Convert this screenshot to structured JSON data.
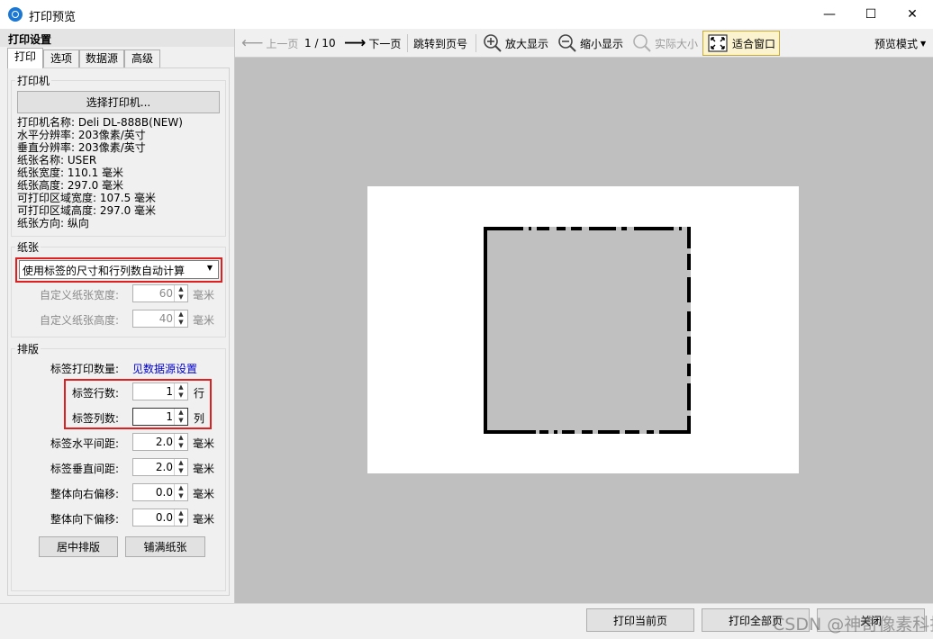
{
  "window": {
    "title": "打印预览",
    "minimize": "—",
    "maximize": "☐",
    "close": "✕"
  },
  "left": {
    "header": "打印设置",
    "tabs": [
      "打印",
      "选项",
      "数据源",
      "高级"
    ],
    "printer": {
      "group_title": "打印机",
      "select_button": "选择打印机...",
      "info": [
        "打印机名称: Deli DL-888B(NEW)",
        "水平分辨率: 203像素/英寸",
        "垂直分辨率: 203像素/英寸",
        "纸张名称: USER",
        "纸张宽度: 110.1 毫米",
        "纸张高度: 297.0 毫米",
        "可打印区域宽度: 107.5 毫米",
        "可打印区域高度: 297.0 毫米",
        "纸张方向: 纵向"
      ]
    },
    "paper": {
      "group_title": "纸张",
      "mode": "使用标签的尺寸和行列数自动计算",
      "custom_width_label": "自定义纸张宽度:",
      "custom_width": "60",
      "custom_height_label": "自定义纸张高度:",
      "custom_height": "40",
      "unit": "毫米"
    },
    "layout": {
      "group_title": "排版",
      "count_label": "标签打印数量:",
      "count_link": "见数据源设置",
      "rows_label": "标签行数:",
      "rows": "1",
      "rows_unit": "行",
      "cols_label": "标签列数:",
      "cols": "1",
      "cols_unit": "列",
      "hgap_label": "标签水平间距:",
      "hgap": "2.0",
      "vgap_label": "标签垂直间距:",
      "vgap": "2.0",
      "xoff_label": "整体向右偏移:",
      "xoff": "0.0",
      "yoff_label": "整体向下偏移:",
      "yoff": "0.0",
      "unit": "毫米",
      "center_button": "居中排版",
      "fill_button": "铺满纸张"
    }
  },
  "toolbar": {
    "prev": "上一页",
    "page": "1 / 10",
    "next": "下一页",
    "goto": "跳转到页号",
    "zoom_in": "放大显示",
    "zoom_out": "缩小显示",
    "actual": "实际大小",
    "fit": "适合窗口",
    "mode": "预览模式"
  },
  "bottom": {
    "print_current": "打印当前页",
    "print_all": "打印全部页",
    "close": "关闭",
    "watermark": "CSDN @神奇像素科技"
  },
  "icons": {
    "prev": "arrow-left-icon",
    "next": "arrow-right-icon",
    "zoom_in": "zoom-in-icon",
    "zoom_out": "zoom-out-icon",
    "actual": "actual-size-icon",
    "fit": "fit-window-icon"
  },
  "colors": {
    "accent": "#1a78d4",
    "highlight_box": "#e02020",
    "preview_bg": "#bfbfbf",
    "link": "#0000cc"
  }
}
